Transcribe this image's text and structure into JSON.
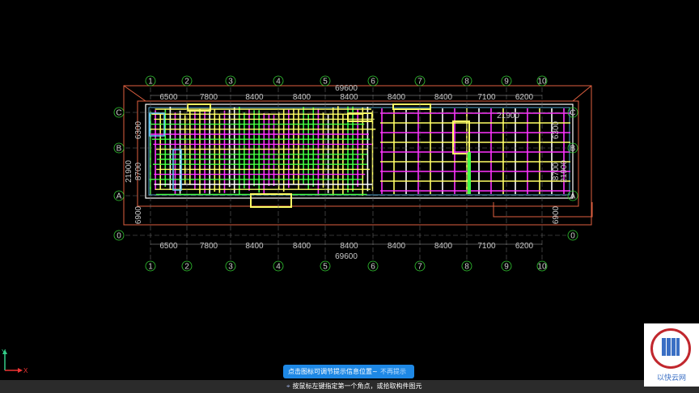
{
  "drawing": {
    "grid_columns": [
      "1",
      "2",
      "3",
      "4",
      "5",
      "6",
      "7",
      "8",
      "9",
      "10"
    ],
    "grid_rows": [
      "C",
      "B",
      "A",
      "0"
    ],
    "span_dims": [
      "6500",
      "7800",
      "8400",
      "8400",
      "8400",
      "8400",
      "8400",
      "7100",
      "6200"
    ],
    "total_length": "69600",
    "left_dims": {
      "top": "6300",
      "mid": "8700",
      "total": "21900",
      "bottom": "6900"
    },
    "right_dims": {
      "top": "6300",
      "mid": "8700",
      "total": "21900",
      "bottom": "6900"
    },
    "top_right_label": "21900",
    "colors": {
      "grid": "#ffffff",
      "outline": "#e06040",
      "beam_y": "#ffff66",
      "beam_m": "#ff33ff",
      "beam_g": "#44ff44",
      "beam_w": "#ffffff",
      "beam_c": "#66ccff"
    }
  },
  "ucs": {
    "x_label": "X",
    "y_label": "Y"
  },
  "tip": {
    "message": "点击图标可调节提示信息位置~",
    "dismiss": "不再提示"
  },
  "status": {
    "prompt": "按鼠标左键指定第一个角点，或拾取构件图元"
  },
  "logo": {
    "text": "以快云网"
  }
}
